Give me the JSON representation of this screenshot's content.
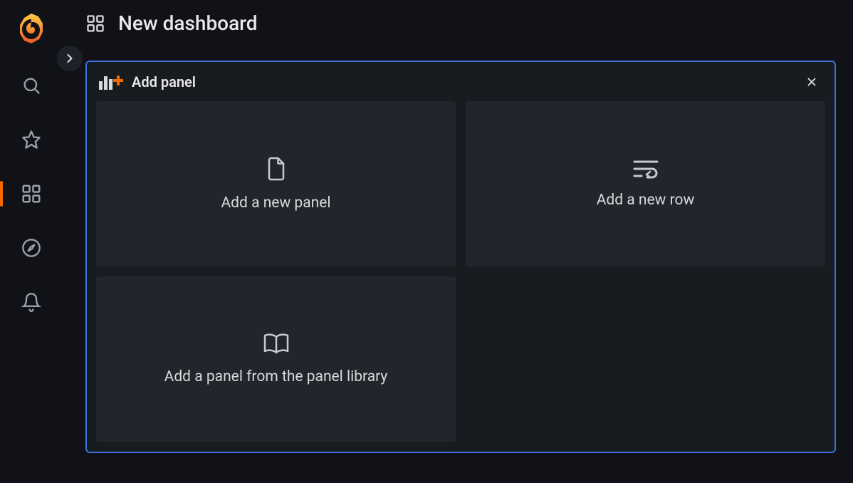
{
  "header": {
    "title": "New dashboard"
  },
  "panel": {
    "title": "Add panel",
    "cards": [
      {
        "label": "Add a new panel"
      },
      {
        "label": "Add a new row"
      },
      {
        "label": "Add a panel from the panel library"
      }
    ]
  }
}
